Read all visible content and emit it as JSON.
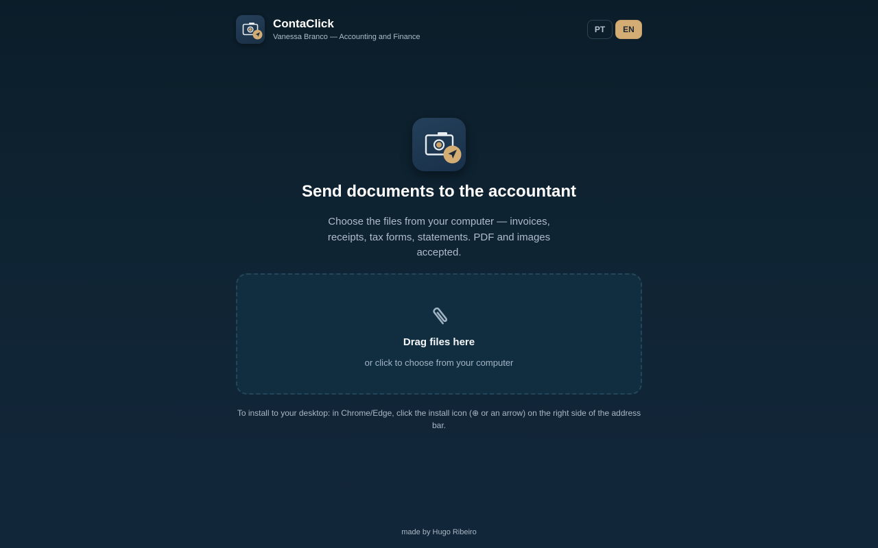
{
  "header": {
    "app_name": "ContaClick",
    "subtitle": "Vanessa Branco — Accounting and Finance",
    "logo_icon": "camera-send-icon",
    "languages": [
      {
        "label": "PT",
        "active": false
      },
      {
        "label": "EN",
        "active": true
      }
    ]
  },
  "main": {
    "icon": "camera-send-icon",
    "title": "Send documents to the accountant",
    "description": "Choose the files from your computer — invoices, receipts, tax forms, statements. PDF and images accepted."
  },
  "dropzone": {
    "icon": "paperclip-icon",
    "title": "Drag files here",
    "subtitle": "or click to choose from your computer"
  },
  "install_note": "To install to your desktop: in Chrome/Edge, click the install icon (⊕ or an arrow) on the right side of the address bar.",
  "footer": {
    "credit": "made by Hugo Ribeiro"
  },
  "colors": {
    "accent": "#d3ad74",
    "background_top": "#0b1d29",
    "background_bottom": "#12263a"
  }
}
